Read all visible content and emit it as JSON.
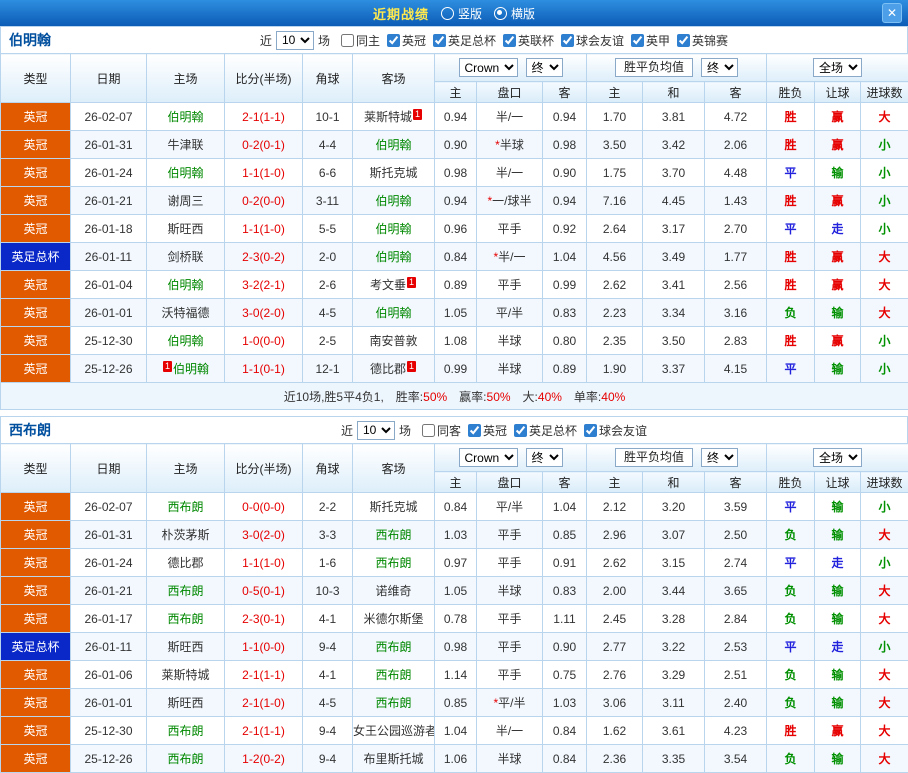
{
  "topbar": {
    "title": "近期战绩",
    "view_options": [
      {
        "label": "竖版",
        "selected": false
      },
      {
        "label": "横版",
        "selected": true
      }
    ],
    "close_label": "✕"
  },
  "filter_bar": {
    "recent": "近",
    "count": "10",
    "matches": "场"
  },
  "table_header": {
    "type": "类型",
    "date": "日期",
    "home": "主场",
    "score": "比分(半场)",
    "corner": "角球",
    "away": "客场",
    "bookmaker": "Crown",
    "period_final": "终",
    "odds_home": "主",
    "odds_handicap": "盘口",
    "odds_away": "客",
    "avg_label": "胜平负均值",
    "avg_home": "主",
    "avg_draw": "和",
    "avg_away": "客",
    "scope": "全场",
    "result": "胜负",
    "handicap_result": "让球",
    "goals": "进球数"
  },
  "league_colors": {
    "英冠": "#e25a00",
    "英足总杯": "#0a28c8"
  },
  "result_colors": {
    "胜": "#e60000",
    "平": "#2222dd",
    "负": "#009000",
    "赢": "#e60000",
    "走": "#2222dd",
    "输": "#009000",
    "大": "#e60000",
    "小": "#009000"
  },
  "sections": [
    {
      "team": "伯明翰",
      "filters": [
        {
          "label": "同主",
          "checked": false
        },
        {
          "label": "英冠",
          "checked": true
        },
        {
          "label": "英足总杯",
          "checked": true
        },
        {
          "label": "英联杯",
          "checked": true
        },
        {
          "label": "球会友谊",
          "checked": true
        },
        {
          "label": "英甲",
          "checked": true
        },
        {
          "label": "英锦赛",
          "checked": true
        }
      ],
      "rows": [
        {
          "league": "英冠",
          "date": "26-02-07",
          "home": "伯明翰",
          "home_team": true,
          "score": "2-1(1-1)",
          "corner": "10-1",
          "away": "莱斯特城",
          "away_badge": "1",
          "odds": [
            "0.94",
            "半/一",
            "0.94"
          ],
          "avg": [
            "1.70",
            "3.81",
            "4.72"
          ],
          "res": [
            "胜",
            "赢",
            "大"
          ]
        },
        {
          "league": "英冠",
          "date": "26-01-31",
          "home": "牛津联",
          "score": "0-2(0-1)",
          "corner": "4-4",
          "away": "伯明翰",
          "away_team": true,
          "odds": [
            "0.90",
            "*半球",
            "0.98"
          ],
          "avg": [
            "3.50",
            "3.42",
            "2.06"
          ],
          "res": [
            "胜",
            "赢",
            "小"
          ]
        },
        {
          "league": "英冠",
          "date": "26-01-24",
          "home": "伯明翰",
          "home_team": true,
          "score": "1-1(1-0)",
          "corner": "6-6",
          "away": "斯托克城",
          "odds": [
            "0.98",
            "半/一",
            "0.90"
          ],
          "avg": [
            "1.75",
            "3.70",
            "4.48"
          ],
          "res": [
            "平",
            "输",
            "小"
          ]
        },
        {
          "league": "英冠",
          "date": "26-01-21",
          "home": "谢周三",
          "score": "0-2(0-0)",
          "corner": "3-11",
          "away": "伯明翰",
          "away_team": true,
          "odds": [
            "0.94",
            "*一/球半",
            "0.94"
          ],
          "avg": [
            "7.16",
            "4.45",
            "1.43"
          ],
          "res": [
            "胜",
            "赢",
            "小"
          ]
        },
        {
          "league": "英冠",
          "date": "26-01-18",
          "home": "斯旺西",
          "score": "1-1(1-0)",
          "corner": "5-5",
          "away": "伯明翰",
          "away_team": true,
          "odds": [
            "0.96",
            "平手",
            "0.92"
          ],
          "avg": [
            "2.64",
            "3.17",
            "2.70"
          ],
          "res": [
            "平",
            "走",
            "小"
          ]
        },
        {
          "league": "英足总杯",
          "date": "26-01-11",
          "home": "剑桥联",
          "score": "2-3(0-2)",
          "corner": "2-0",
          "away": "伯明翰",
          "away_team": true,
          "odds": [
            "0.84",
            "*半/一",
            "1.04"
          ],
          "avg": [
            "4.56",
            "3.49",
            "1.77"
          ],
          "res": [
            "胜",
            "赢",
            "大"
          ]
        },
        {
          "league": "英冠",
          "date": "26-01-04",
          "home": "伯明翰",
          "home_team": true,
          "score": "3-2(2-1)",
          "corner": "2-6",
          "away": "考文垂",
          "away_badge": "1",
          "odds": [
            "0.89",
            "平手",
            "0.99"
          ],
          "avg": [
            "2.62",
            "3.41",
            "2.56"
          ],
          "res": [
            "胜",
            "赢",
            "大"
          ]
        },
        {
          "league": "英冠",
          "date": "26-01-01",
          "home": "沃特福德",
          "score": "3-0(2-0)",
          "corner": "4-5",
          "away": "伯明翰",
          "away_team": true,
          "odds": [
            "1.05",
            "平/半",
            "0.83"
          ],
          "avg": [
            "2.23",
            "3.34",
            "3.16"
          ],
          "res": [
            "负",
            "输",
            "大"
          ]
        },
        {
          "league": "英冠",
          "date": "25-12-30",
          "home": "伯明翰",
          "home_team": true,
          "score": "1-0(0-0)",
          "corner": "2-5",
          "away": "南安普敦",
          "odds": [
            "1.08",
            "半球",
            "0.80"
          ],
          "avg": [
            "2.35",
            "3.50",
            "2.83"
          ],
          "res": [
            "胜",
            "赢",
            "小"
          ]
        },
        {
          "league": "英冠",
          "date": "25-12-26",
          "home": "伯明翰",
          "home_team": true,
          "home_badge": "1",
          "home_badge_pos": "before",
          "score": "1-1(0-1)",
          "corner": "12-1",
          "away": "德比郡",
          "away_badge": "1",
          "odds": [
            "0.99",
            "半球",
            "0.89"
          ],
          "avg": [
            "1.90",
            "3.37",
            "4.15"
          ],
          "res": [
            "平",
            "输",
            "小"
          ]
        }
      ],
      "summary": {
        "prefix": "近10场,胜5平4负1,",
        "stats": [
          {
            "label": "胜率:",
            "value": "50%"
          },
          {
            "label": "赢率:",
            "value": "50%"
          },
          {
            "label": "大:",
            "value": "40%"
          },
          {
            "label": "单率:",
            "value": "40%"
          }
        ]
      }
    },
    {
      "team": "西布朗",
      "filters": [
        {
          "label": "同客",
          "checked": false
        },
        {
          "label": "英冠",
          "checked": true
        },
        {
          "label": "英足总杯",
          "checked": true
        },
        {
          "label": "球会友谊",
          "checked": true
        }
      ],
      "rows": [
        {
          "league": "英冠",
          "date": "26-02-07",
          "home": "西布朗",
          "home_team": true,
          "score": "0-0(0-0)",
          "corner": "2-2",
          "away": "斯托克城",
          "odds": [
            "0.84",
            "平/半",
            "1.04"
          ],
          "avg": [
            "2.12",
            "3.20",
            "3.59"
          ],
          "res": [
            "平",
            "输",
            "小"
          ]
        },
        {
          "league": "英冠",
          "date": "26-01-31",
          "home": "朴茨茅斯",
          "score": "3-0(2-0)",
          "corner": "3-3",
          "away": "西布朗",
          "away_team": true,
          "odds": [
            "1.03",
            "平手",
            "0.85"
          ],
          "avg": [
            "2.96",
            "3.07",
            "2.50"
          ],
          "res": [
            "负",
            "输",
            "大"
          ]
        },
        {
          "league": "英冠",
          "date": "26-01-24",
          "home": "德比郡",
          "score": "1-1(1-0)",
          "corner": "1-6",
          "away": "西布朗",
          "away_team": true,
          "odds": [
            "0.97",
            "平手",
            "0.91"
          ],
          "avg": [
            "2.62",
            "3.15",
            "2.74"
          ],
          "res": [
            "平",
            "走",
            "小"
          ]
        },
        {
          "league": "英冠",
          "date": "26-01-21",
          "home": "西布朗",
          "home_team": true,
          "score": "0-5(0-1)",
          "corner": "10-3",
          "away": "诺维奇",
          "odds": [
            "1.05",
            "半球",
            "0.83"
          ],
          "avg": [
            "2.00",
            "3.44",
            "3.65"
          ],
          "res": [
            "负",
            "输",
            "大"
          ]
        },
        {
          "league": "英冠",
          "date": "26-01-17",
          "home": "西布朗",
          "home_team": true,
          "score": "2-3(0-1)",
          "corner": "4-1",
          "away": "米德尔斯堡",
          "odds": [
            "0.78",
            "平手",
            "1.11"
          ],
          "avg": [
            "2.45",
            "3.28",
            "2.84"
          ],
          "res": [
            "负",
            "输",
            "大"
          ]
        },
        {
          "league": "英足总杯",
          "date": "26-01-11",
          "home": "斯旺西",
          "score": "1-1(0-0)",
          "corner": "9-4",
          "away": "西布朗",
          "away_team": true,
          "odds": [
            "0.98",
            "平手",
            "0.90"
          ],
          "avg": [
            "2.77",
            "3.22",
            "2.53"
          ],
          "res": [
            "平",
            "走",
            "小"
          ]
        },
        {
          "league": "英冠",
          "date": "26-01-06",
          "home": "莱斯特城",
          "score": "2-1(1-1)",
          "corner": "4-1",
          "away": "西布朗",
          "away_team": true,
          "odds": [
            "1.14",
            "平手",
            "0.75"
          ],
          "avg": [
            "2.76",
            "3.29",
            "2.51"
          ],
          "res": [
            "负",
            "输",
            "大"
          ]
        },
        {
          "league": "英冠",
          "date": "26-01-01",
          "home": "斯旺西",
          "score": "2-1(1-0)",
          "corner": "4-5",
          "away": "西布朗",
          "away_team": true,
          "odds": [
            "0.85",
            "*平/半",
            "1.03"
          ],
          "avg": [
            "3.06",
            "3.11",
            "2.40"
          ],
          "res": [
            "负",
            "输",
            "大"
          ]
        },
        {
          "league": "英冠",
          "date": "25-12-30",
          "home": "西布朗",
          "home_team": true,
          "score": "2-1(1-1)",
          "corner": "9-4",
          "away": "女王公园巡游者",
          "odds": [
            "1.04",
            "半/一",
            "0.84"
          ],
          "avg": [
            "1.62",
            "3.61",
            "4.23"
          ],
          "res": [
            "胜",
            "赢",
            "大"
          ]
        },
        {
          "league": "英冠",
          "date": "25-12-26",
          "home": "西布朗",
          "home_team": true,
          "score": "1-2(0-2)",
          "corner": "9-4",
          "away": "布里斯托城",
          "odds": [
            "1.06",
            "半球",
            "0.84"
          ],
          "avg": [
            "2.36",
            "3.35",
            "3.54"
          ],
          "res": [
            "负",
            "输",
            "大"
          ]
        }
      ]
    }
  ]
}
